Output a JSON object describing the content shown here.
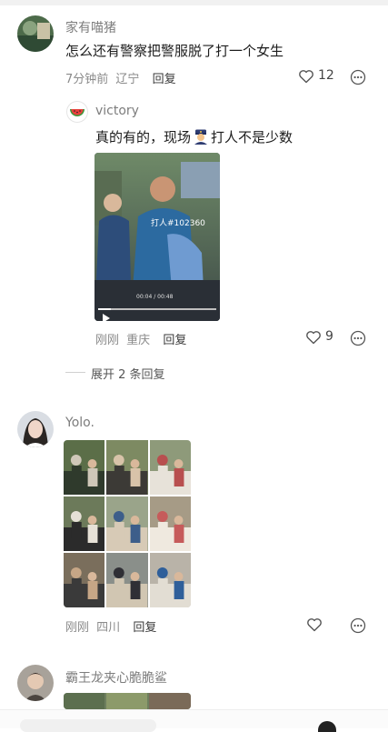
{
  "comments": [
    {
      "username": "家有喵猪",
      "text": "怎么还有警察把警服脱了打一个女生",
      "time": "7分钟前",
      "location": "辽宁",
      "reply_label": "回复",
      "likes": "12",
      "replies": [
        {
          "username": "victory",
          "text_before": "真的有的，现场",
          "emoji": "police-officer-emoji",
          "text_after": "打人不是少数",
          "video_caption": "打人#102360",
          "video_timecode": "00:04 / 00:48",
          "time": "刚刚",
          "location": "重庆",
          "reply_label": "回复",
          "likes": "9"
        }
      ],
      "expand_label": "展开 2 条回复"
    },
    {
      "username": "Yolo.",
      "time": "刚刚",
      "location": "四川",
      "reply_label": "回复"
    },
    {
      "username": "霸王龙夹心脆脆鲨"
    }
  ],
  "icons": {
    "like": "heart-outline-icon",
    "more": "more-circle-icon",
    "play": "play-icon"
  },
  "colors": {
    "muted_text": "#8a8a8a",
    "body_text": "#1d1d1d"
  }
}
